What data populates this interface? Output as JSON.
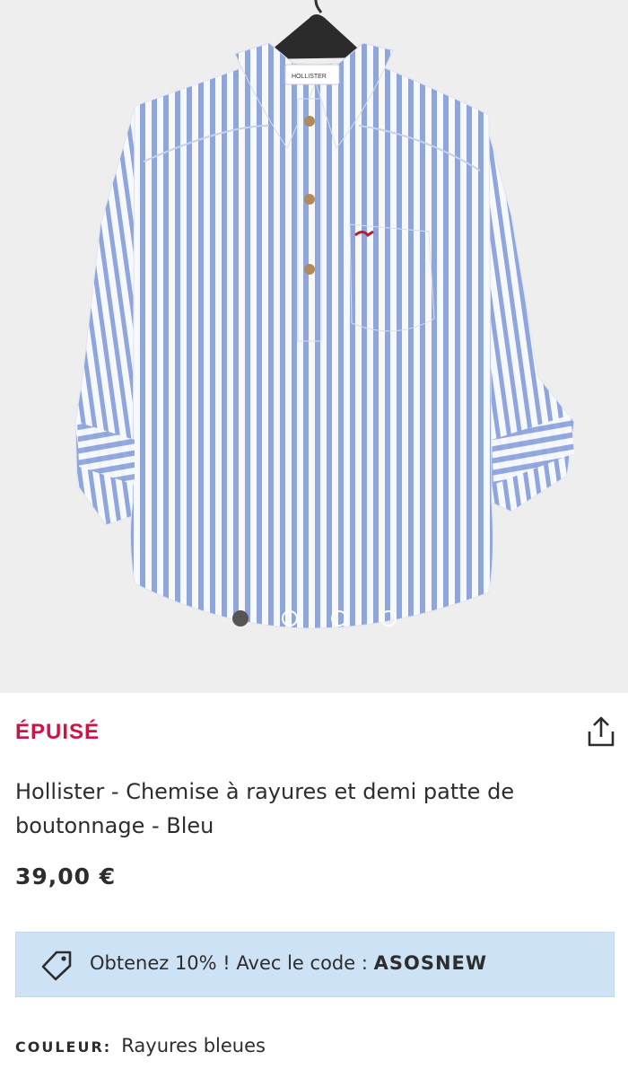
{
  "product": {
    "status": "ÉPUISÉ",
    "title": "Hollister - Chemise à rayures et demi patte de boutonnage - Bleu",
    "price": "39,00 €",
    "colour_label": "COULEUR:",
    "colour_value": "Rayures bleues"
  },
  "gallery": {
    "image_count": 4,
    "active_index": 0,
    "label_text": "HOLLISTER"
  },
  "promo": {
    "text": "Obtenez 10% ! Avec le code : ",
    "code": "ASOSNEW",
    "icon": "tag-icon"
  },
  "icons": {
    "share": "share-icon"
  },
  "colors": {
    "status": "#d01345",
    "promo_bg": "#cde2f5",
    "stripe_blue": "#8fa6dc",
    "gallery_bg": "#eeeeee"
  }
}
